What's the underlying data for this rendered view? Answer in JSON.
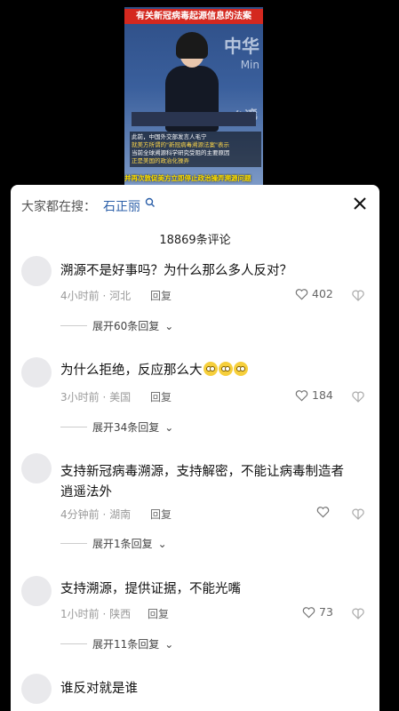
{
  "video": {
    "title": "有关新冠病毒起源信息的法案",
    "logo_text": "中华",
    "logo_sub": "Min",
    "watermark": "台湾",
    "caption_line1": "此前，中国外交部发言人毛宁",
    "caption_line2": "就美方所谓的\"新冠病毒溯源法案\"表示",
    "caption_line3": "当前全球溯源科学研究受阻的主要原因",
    "caption_line4": "正是美国的政治化操弄",
    "caption_bottom": "并再次敦促美方立即停止政治操弄溯源问题"
  },
  "panel": {
    "search_label": "大家都在搜：",
    "search_term": "石正丽",
    "comment_count": "18869条评论"
  },
  "comments": [
    {
      "text": "溯源不是好事吗？为什么那么多人反对？",
      "meta": "4小时前 · 河北",
      "reply": "回复",
      "likes": "402",
      "expand": "展开60条回复"
    },
    {
      "text": "为什么拒绝，反应那么大",
      "meta": "3小时前 · 美国",
      "reply": "回复",
      "likes": "184",
      "expand": "展开34条回复"
    },
    {
      "text": "支持新冠病毒溯源，支持解密，不能让病毒制造者逍遥法外",
      "meta": "4分钟前 · 湖南",
      "reply": "回复",
      "likes": "",
      "expand": "展开1条回复"
    },
    {
      "text": "支持溯源，提供证据，不能光嘴",
      "meta": "1小时前 · 陕西",
      "reply": "回复",
      "likes": "73",
      "expand": "展开11条回复"
    },
    {
      "text": "谁反对就是谁"
    }
  ]
}
